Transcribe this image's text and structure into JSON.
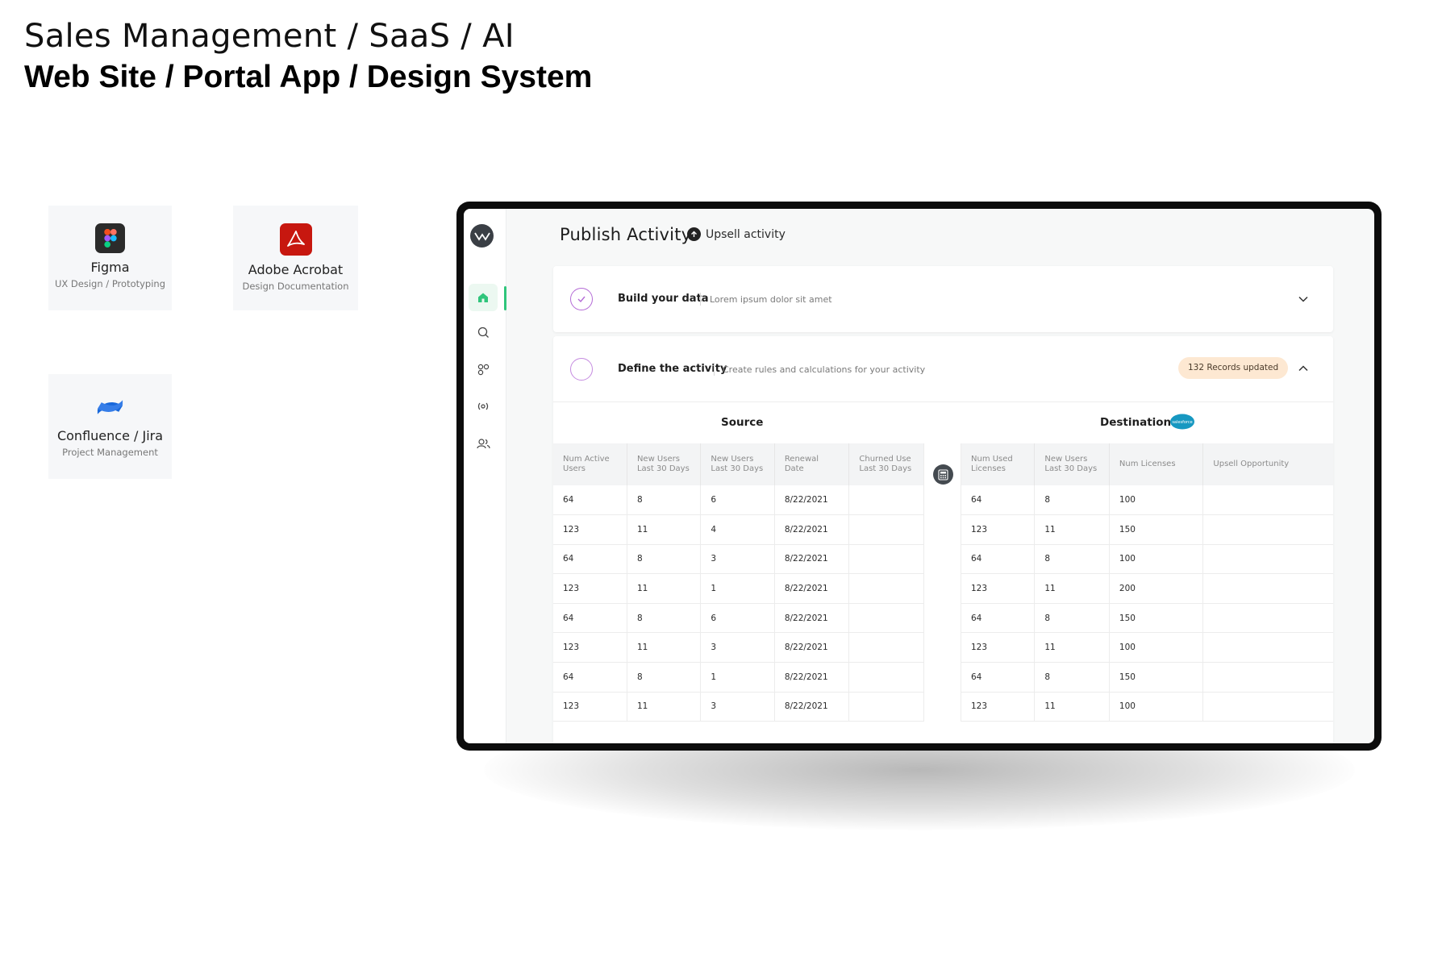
{
  "header": {
    "subtitle": "Sales Management / SaaS / AI",
    "title": "Web Site / Portal App / Design System"
  },
  "tools": [
    {
      "name": "Figma",
      "desc": "UX Design / Prototyping",
      "icon": "figma-icon"
    },
    {
      "name": "Adobe Acrobat",
      "desc": "Design Documentation",
      "icon": "acrobat-icon"
    },
    {
      "name": "Confluence / Jira",
      "desc": "Project Management",
      "icon": "confluence-icon"
    }
  ],
  "app": {
    "page_title": "Publish Activity",
    "breadcrumb": "Upsell activity",
    "nav": [
      "home-icon",
      "search-icon",
      "apps-icon",
      "broadcast-icon",
      "users-icon"
    ],
    "steps": [
      {
        "title": "Build your data",
        "desc": "Lorem ipsum dolor sit amet"
      },
      {
        "title": "Define the activity",
        "desc": "Create rules and calculations for your activity",
        "badge": "132 Records updated"
      }
    ],
    "source": {
      "heading": "Source",
      "columns": [
        [
          "Num Active",
          "Users"
        ],
        [
          "New Users",
          "Last 30 Days"
        ],
        [
          "New Users",
          "Last 30 Days"
        ],
        [
          "Renewal Date",
          ""
        ],
        [
          "Churned Use",
          "Last 30 Days"
        ]
      ],
      "rows": [
        [
          "64",
          "8",
          "6",
          "8/22/2021",
          ""
        ],
        [
          "123",
          "11",
          "4",
          "8/22/2021",
          ""
        ],
        [
          "64",
          "8",
          "3",
          "8/22/2021",
          ""
        ],
        [
          "123",
          "11",
          "1",
          "8/22/2021",
          ""
        ],
        [
          "64",
          "8",
          "6",
          "8/22/2021",
          ""
        ],
        [
          "123",
          "11",
          "3",
          "8/22/2021",
          ""
        ],
        [
          "64",
          "8",
          "1",
          "8/22/2021",
          ""
        ],
        [
          "123",
          "11",
          "3",
          "8/22/2021",
          ""
        ]
      ]
    },
    "destination": {
      "heading": "Destination",
      "columns": [
        [
          "Num Used",
          "Licenses"
        ],
        [
          "New Users",
          "Last 30 Days"
        ],
        [
          "Num Licenses",
          ""
        ],
        [
          "Upsell Opportunity",
          ""
        ]
      ],
      "rows": [
        [
          "64",
          "8",
          "100",
          ""
        ],
        [
          "123",
          "11",
          "150",
          ""
        ],
        [
          "64",
          "8",
          "100",
          ""
        ],
        [
          "123",
          "11",
          "200",
          ""
        ],
        [
          "64",
          "8",
          "150",
          ""
        ],
        [
          "123",
          "11",
          "100",
          ""
        ],
        [
          "64",
          "8",
          "150",
          ""
        ],
        [
          "123",
          "11",
          "100",
          ""
        ]
      ]
    },
    "colors": {
      "accent": "#2fc57b",
      "step": "#b46bd6",
      "badge_bg": "#fde8d2",
      "salesforce": "#1798c1"
    }
  }
}
